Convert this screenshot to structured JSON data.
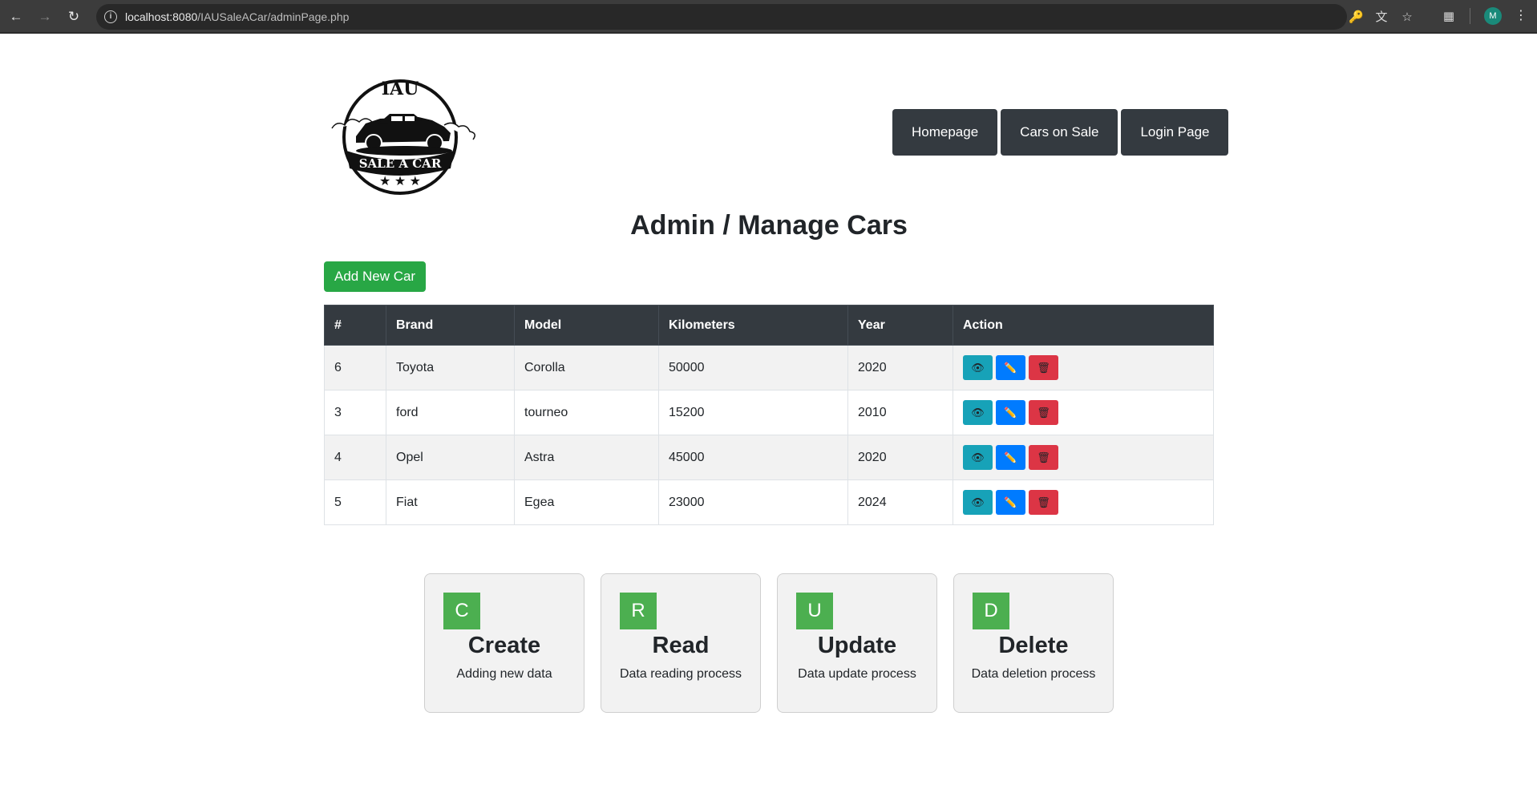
{
  "browser": {
    "url_host": "localhost:8080",
    "url_path": "/IAUSaleACar/adminPage.php",
    "profile_initial": "M"
  },
  "logo": {
    "top_text": "IAU",
    "banner_text": "SALE A CAR"
  },
  "nav": {
    "items": [
      {
        "label": "Homepage"
      },
      {
        "label": "Cars on Sale"
      },
      {
        "label": "Login Page"
      }
    ]
  },
  "page": {
    "title": "Admin / Manage Cars",
    "add_button": "Add New Car"
  },
  "table": {
    "headers": [
      "#",
      "Brand",
      "Model",
      "Kilometers",
      "Year",
      "Action"
    ],
    "rows": [
      {
        "id": "6",
        "brand": "Toyota",
        "model": "Corolla",
        "km": "50000",
        "year": "2020"
      },
      {
        "id": "3",
        "brand": "ford",
        "model": "tourneo",
        "km": "15200",
        "year": "2010"
      },
      {
        "id": "4",
        "brand": "Opel",
        "model": "Astra",
        "km": "45000",
        "year": "2020"
      },
      {
        "id": "5",
        "brand": "Fiat",
        "model": "Egea",
        "km": "23000",
        "year": "2024"
      }
    ],
    "action_icons": [
      "eye-icon",
      "pencil-icon",
      "wastebasket-icon"
    ]
  },
  "cards": [
    {
      "letter": "C",
      "title": "Create",
      "desc": "Adding new data"
    },
    {
      "letter": "R",
      "title": "Read",
      "desc": "Data reading process"
    },
    {
      "letter": "U",
      "title": "Update",
      "desc": "Data update process"
    },
    {
      "letter": "D",
      "title": "Delete",
      "desc": "Data deletion process"
    }
  ],
  "colors": {
    "nav_bg": "#343a40",
    "add_green": "#28a745",
    "view_teal": "#17a2b8",
    "edit_blue": "#007bff",
    "delete_red": "#dc3545",
    "card_letter_green": "#4caf50"
  }
}
